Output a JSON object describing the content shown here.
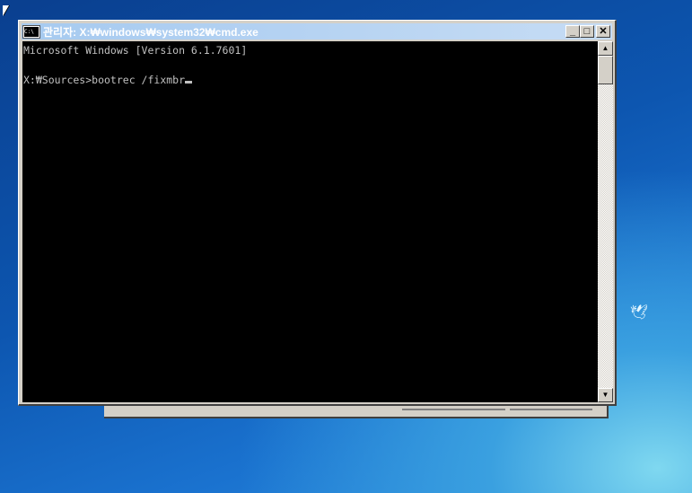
{
  "window": {
    "title": "관리자: X:₩windows₩system32₩cmd.exe",
    "icon": "cmd-icon",
    "icon_text": "C:\\"
  },
  "buttons": {
    "minimize": "_",
    "maximize": "□",
    "close": "✕"
  },
  "console": {
    "lines": [
      "Microsoft Windows [Version 6.1.7601]",
      "",
      "X:₩Sources>bootrec /fixmbr"
    ]
  },
  "scrollbar": {
    "up": "▲",
    "down": "▼"
  }
}
